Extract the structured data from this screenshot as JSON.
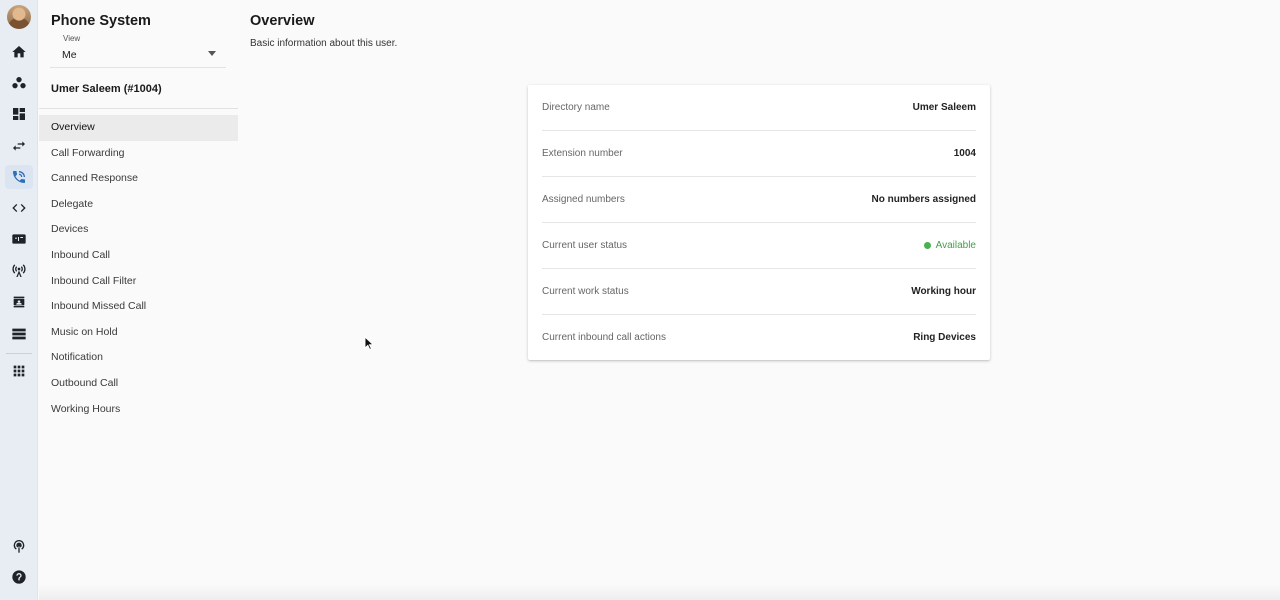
{
  "rail": {
    "icons": [
      "home-icon",
      "people-icon",
      "dashboard-icon",
      "transfer-icon",
      "phone-icon",
      "code-icon",
      "sip-icon",
      "antenna-icon",
      "contact-card-icon",
      "list-icon",
      "apps-grid-icon",
      "podcast-icon",
      "help-icon"
    ],
    "active": "phone-icon",
    "accent": "#2f6fb5"
  },
  "sidebar": {
    "title": "Phone System",
    "view": {
      "label": "View",
      "value": "Me"
    },
    "user": "Umer Saleem (#1004)",
    "items": [
      "Overview",
      "Call Forwarding",
      "Canned Response",
      "Delegate",
      "Devices",
      "Inbound Call",
      "Inbound Call Filter",
      "Inbound Missed Call",
      "Music on Hold",
      "Notification",
      "Outbound Call",
      "Working Hours"
    ],
    "active_item": "Overview"
  },
  "main": {
    "title": "Overview",
    "subtitle": "Basic information about this user."
  },
  "details": {
    "directory_name": {
      "label": "Directory name",
      "value": "Umer Saleem"
    },
    "extension_number": {
      "label": "Extension number",
      "value": "1004"
    },
    "assigned_numbers": {
      "label": "Assigned numbers",
      "value": "No numbers assigned"
    },
    "user_status": {
      "label": "Current user status",
      "value": "Available",
      "color": "#43a047"
    },
    "work_status": {
      "label": "Current work status",
      "value": "Working hour"
    },
    "inbound_actions": {
      "label": "Current inbound call actions",
      "value": "Ring Devices"
    }
  }
}
